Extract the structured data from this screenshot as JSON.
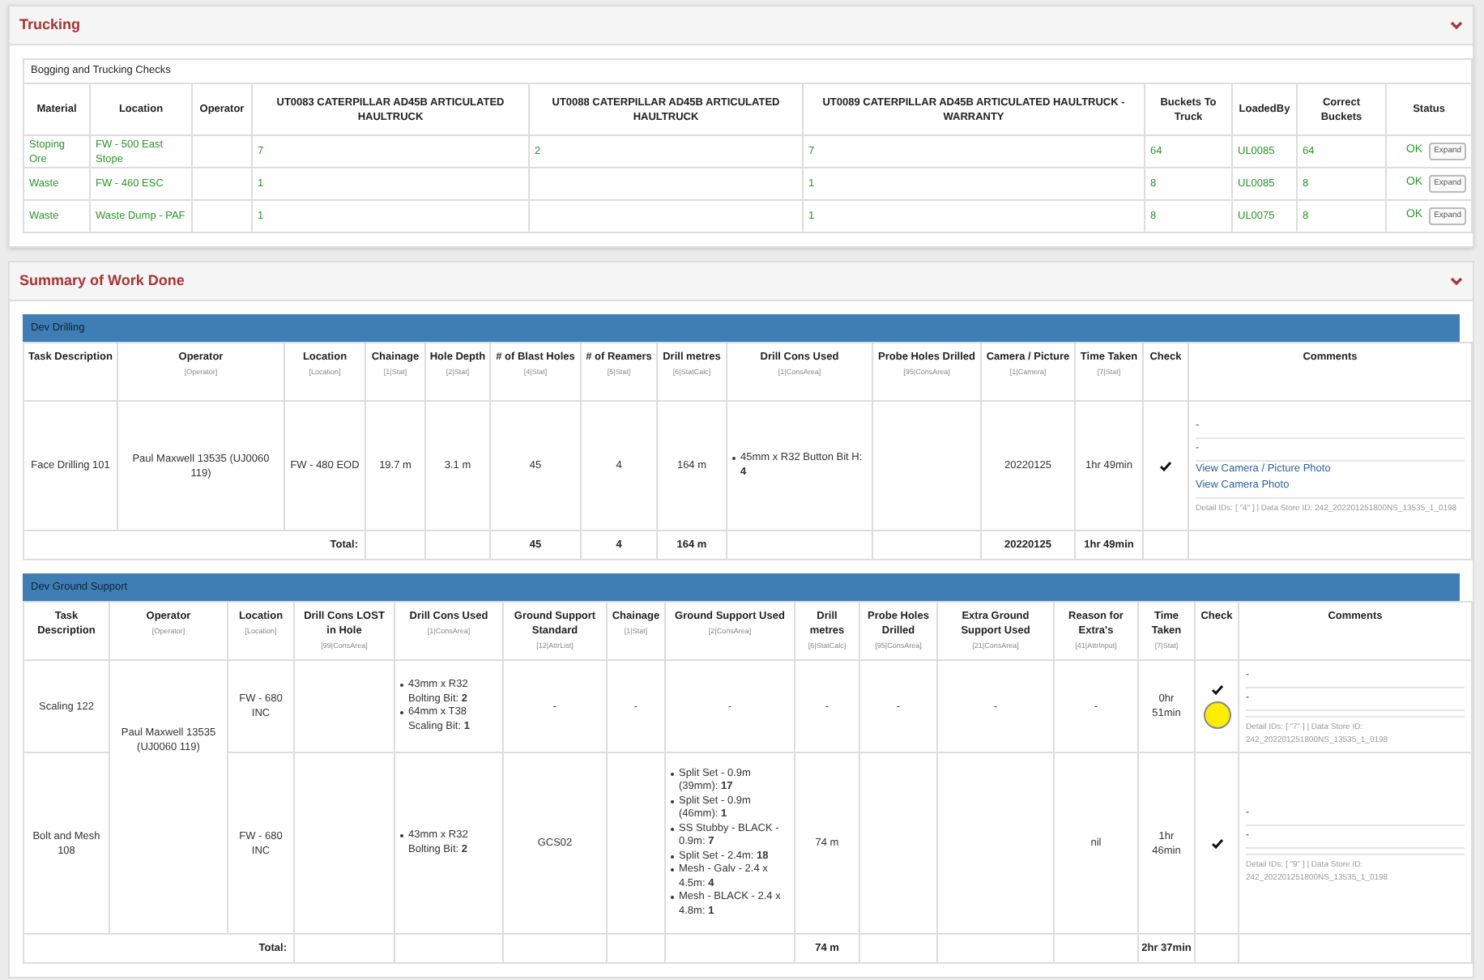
{
  "trucking": {
    "title": "Trucking",
    "checks": {
      "title": "Bogging and Trucking Checks",
      "columns": [
        "Material",
        "Location",
        "Operator",
        "UT0083 CATERPILLAR AD45B ARTICULATED HAULTRUCK",
        "UT0088 CATERPILLAR AD45B ARTICULATED HAULTRUCK",
        "UT0089 CATERPILLAR AD45B ARTICULATED HAULTRUCK - WARRANTY",
        "Buckets To Truck",
        "LoadedBy",
        "Correct Buckets",
        "Status"
      ],
      "rows": [
        {
          "cells": [
            "Stoping Ore",
            "FW - 500 East Stope",
            null,
            "7",
            "2",
            "7",
            "64",
            "UL0085",
            "64"
          ],
          "status": "OK",
          "action": "Expand"
        },
        {
          "cells": [
            "Waste",
            "FW - 460 ESC",
            null,
            "1",
            null,
            "1",
            "8",
            "UL0085",
            "8"
          ],
          "status": "OK",
          "action": "Expand"
        },
        {
          "cells": [
            "Waste",
            "Waste Dump - PAF",
            null,
            "1",
            null,
            "1",
            "8",
            "UL0075",
            "8"
          ],
          "status": "OK",
          "action": "Expand"
        }
      ]
    }
  },
  "summary": {
    "title": "Summary of Work Done",
    "sections": [
      {
        "title": "Dev Drilling",
        "columns": [
          {
            "label": "Task Description"
          },
          {
            "label": "Operator",
            "hint": "[Operator]"
          },
          {
            "label": "Location",
            "hint": "[Location]"
          },
          {
            "label": "Chainage",
            "hint": "[1|Stat]"
          },
          {
            "label": "Hole Depth",
            "hint": "[2|Stat]"
          },
          {
            "label": "# of Blast Holes",
            "hint": "[4|Stat]"
          },
          {
            "label": "# of Reamers",
            "hint": "[5|Stat]"
          },
          {
            "label": "Drill metres",
            "hint": "[6|StatCalc]"
          },
          {
            "label": "Drill Cons Used",
            "hint": "[1|ConsArea]"
          },
          {
            "label": "Probe Holes Drilled",
            "hint": "[95|ConsArea]"
          },
          {
            "label": "Camera / Picture",
            "hint": "[1|Camera]"
          },
          {
            "label": "Time Taken",
            "hint": "[7|Stat]"
          },
          {
            "label": "Check"
          },
          {
            "label": "Comments"
          }
        ],
        "rows": [
          {
            "cells": [
              {
                "kind": "text",
                "text": "Face Drilling 101"
              },
              {
                "kind": "text",
                "text": "Paul Maxwell 13535 (UJ0060 119)"
              },
              {
                "kind": "text",
                "text": "FW - 480 EOD"
              },
              {
                "kind": "text",
                "text": "19.7 m"
              },
              {
                "kind": "text",
                "text": "3.1 m"
              },
              {
                "kind": "text",
                "text": "45"
              },
              {
                "kind": "text",
                "text": "4"
              },
              {
                "kind": "text",
                "text": "164 m"
              },
              {
                "kind": "list",
                "items": [
                  "45mm x R32 Button Bit H: **4**"
                ]
              },
              null,
              {
                "kind": "text",
                "text": "20220125"
              },
              {
                "kind": "text",
                "text": "1hr 49min"
              },
              {
                "kind": "check",
                "checked": true,
                "highlighted": false
              },
              {
                "kind": "comments",
                "lines": [
                  "-",
                  "-"
                ],
                "links": [
                  "View Camera / Picture Photo",
                  "View Camera Photo"
                ],
                "detail": "Detail IDs: [ \"4\" ] | Data Store ID: 242_202201251800NS_13535_1_0198"
              }
            ]
          }
        ],
        "total": {
          "label": "Total:",
          "cells": [
            null,
            null,
            "45",
            "4",
            "164 m",
            null,
            null,
            "20220125",
            "1hr 49min",
            null,
            null
          ]
        }
      },
      {
        "title": "Dev Ground Support",
        "columns": [
          {
            "label": "Task Description"
          },
          {
            "label": "Operator",
            "hint": "[Operator]"
          },
          {
            "label": "Location",
            "hint": "[Location]"
          },
          {
            "label": "Drill Cons LOST in Hole",
            "hint": "[99|ConsArea]"
          },
          {
            "label": "Drill Cons Used",
            "hint": "[1|ConsArea]"
          },
          {
            "label": "Ground Support Standard",
            "hint": "[12|AttrList]"
          },
          {
            "label": "Chainage",
            "hint": "[1|Stat]"
          },
          {
            "label": "Ground Support Used",
            "hint": "[2|ConsArea]"
          },
          {
            "label": "Drill metres",
            "hint": "[6|StatCalc]"
          },
          {
            "label": "Probe Holes Drilled",
            "hint": "[95|ConsArea]"
          },
          {
            "label": "Extra Ground Support Used",
            "hint": "[21|ConsArea]"
          },
          {
            "label": "Reason for Extra's",
            "hint": "[41|AttrInput]"
          },
          {
            "label": "Time Taken",
            "hint": "[7|Stat]"
          },
          {
            "label": "Check"
          },
          {
            "label": "Comments"
          }
        ],
        "rows": [
          {
            "cells": [
              {
                "kind": "text",
                "text": "Scaling 122"
              },
              {
                "kind": "text",
                "text": "Paul Maxwell 13535 (UJ0060 119)",
                "rowspan": 2
              },
              {
                "kind": "text",
                "text": "FW - 680 INC"
              },
              null,
              {
                "kind": "list",
                "items": [
                  "43mm x R32 Bolting Bit: **2**",
                  "64mm x T38 Scaling Bit: **1**"
                ]
              },
              {
                "kind": "text",
                "text": "-"
              },
              {
                "kind": "text",
                "text": "-"
              },
              {
                "kind": "text",
                "text": "-"
              },
              {
                "kind": "text",
                "text": "-"
              },
              {
                "kind": "text",
                "text": "-"
              },
              {
                "kind": "text",
                "text": "-"
              },
              {
                "kind": "text",
                "text": "-"
              },
              {
                "kind": "text",
                "text": "0hr 51min"
              },
              {
                "kind": "check",
                "checked": true,
                "highlighted": true
              },
              {
                "kind": "comments",
                "lines": [
                  "-",
                  "-"
                ],
                "detail": "Detail IDs: [ \"7\" ] | Data Store ID: 242_202201251800NS_13535_1_0198"
              }
            ]
          },
          {
            "cells": [
              {
                "kind": "text",
                "text": "Bolt and Mesh 108"
              },
              {
                "kind": "text",
                "text": "FW - 680 INC"
              },
              null,
              {
                "kind": "list",
                "items": [
                  "43mm x R32 Bolting Bit: **2**"
                ]
              },
              {
                "kind": "text",
                "text": "GCS02"
              },
              null,
              {
                "kind": "list",
                "items": [
                  "Split Set - 0.9m (39mm): **17**",
                  "Split Set - 0.9m (46mm): **1**",
                  "SS Stubby - BLACK - 0.9m: **7**",
                  "Split Set - 2.4m: **18**",
                  "Mesh - Galv - 2.4 x 4.5m: **4**",
                  "Mesh - BLACK - 2.4 x 4.8m: **1**"
                ]
              },
              {
                "kind": "text",
                "text": "74 m"
              },
              null,
              null,
              {
                "kind": "text",
                "text": "nil"
              },
              {
                "kind": "text",
                "text": "1hr 46min"
              },
              {
                "kind": "check",
                "checked": true,
                "highlighted": false
              },
              {
                "kind": "comments",
                "lines": [
                  "-",
                  "-"
                ],
                "detail": "Detail IDs: [ \"9\" ] | Data Store ID: 242_202201251800NS_13535_1_0198"
              }
            ]
          }
        ],
        "total": {
          "label": "Total:",
          "cells": [
            null,
            null,
            null,
            null,
            null,
            "74 m",
            null,
            null,
            null,
            "2hr 37min",
            null,
            null
          ]
        }
      }
    ]
  }
}
